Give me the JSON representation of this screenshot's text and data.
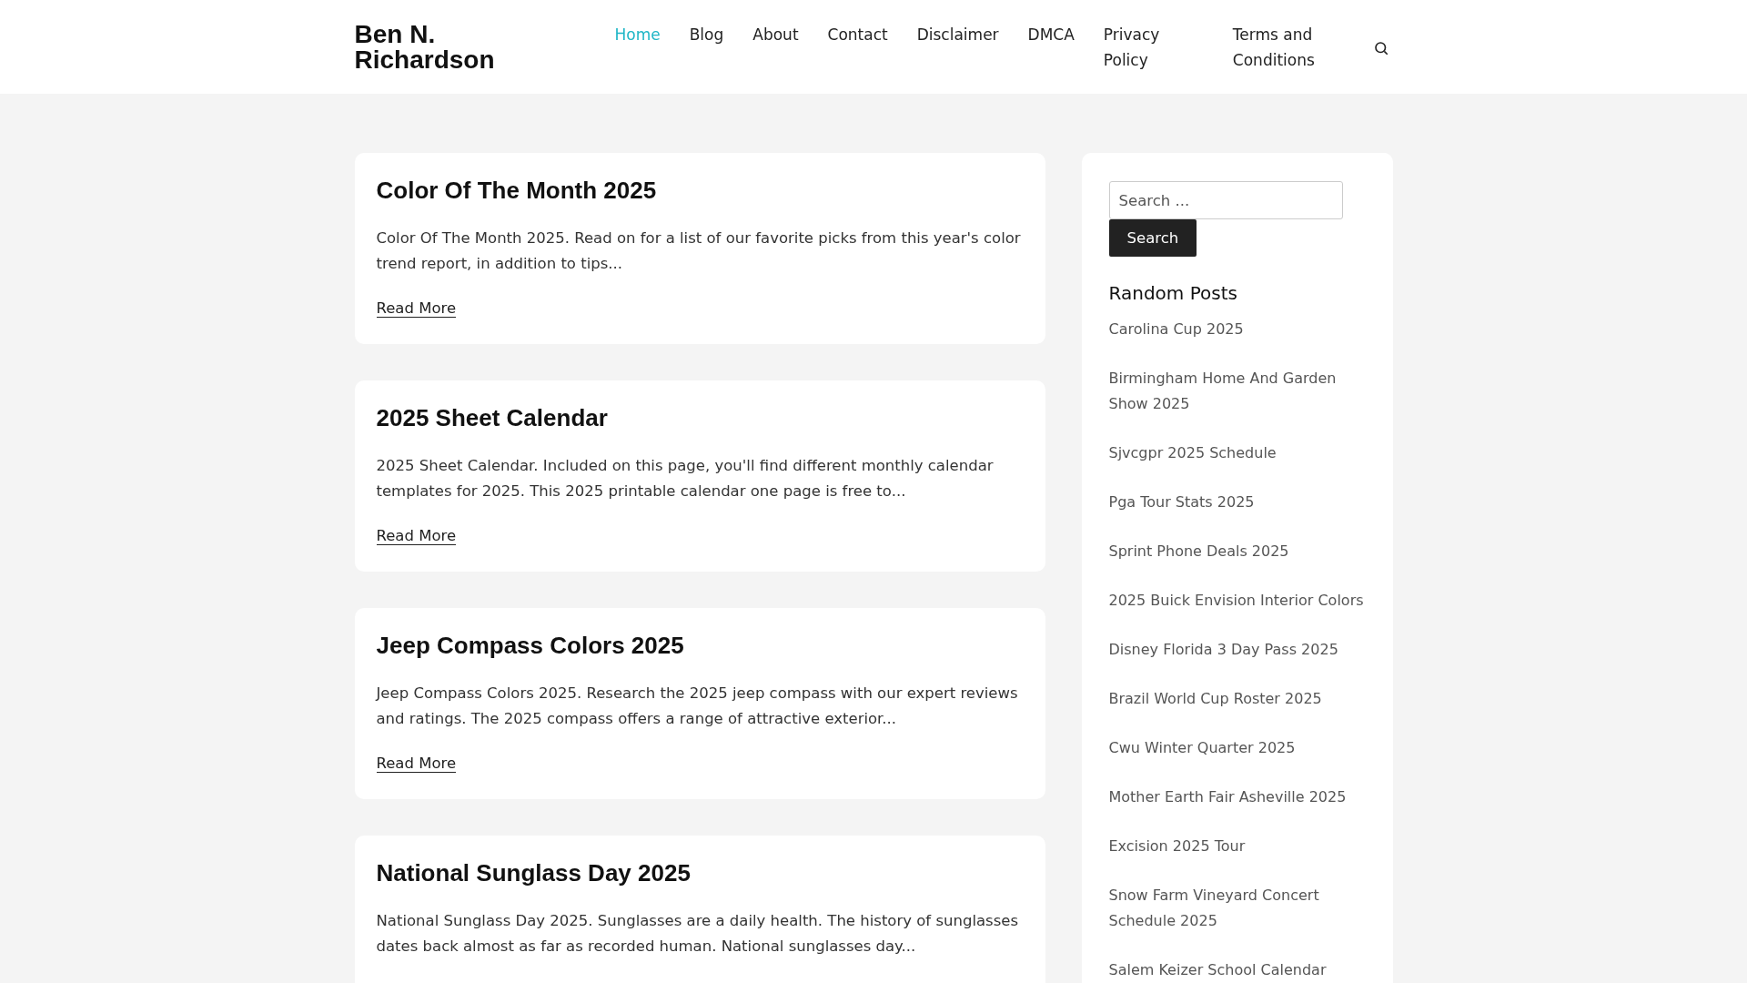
{
  "site_title": "Ben N. Richardson",
  "nav": [
    {
      "label": "Home",
      "selected": true
    },
    {
      "label": "Blog",
      "selected": false
    },
    {
      "label": "About",
      "selected": false
    },
    {
      "label": "Contact",
      "selected": false
    },
    {
      "label": "Disclaimer",
      "selected": false
    },
    {
      "label": "DMCA",
      "selected": false
    },
    {
      "label": "Privacy Policy",
      "selected": false
    },
    {
      "label": "Terms and Conditions",
      "selected": false
    }
  ],
  "posts": [
    {
      "title": "Color Of The Month 2025",
      "excerpt": "Color Of The Month 2025. Read on for a list of our favorite picks from this year's color trend report, in addition to tips...",
      "link": "Read More"
    },
    {
      "title": "2025 Sheet Calendar",
      "excerpt": "2025 Sheet Calendar. Included on this page, you'll find different monthly calendar templates for 2025. This 2025 printable calendar one page is free to...",
      "link": "Read More"
    },
    {
      "title": "Jeep Compass Colors 2025",
      "excerpt": "Jeep Compass Colors 2025. Research the 2025 jeep compass with our expert reviews and ratings. The 2025 compass offers a range of attractive exterior...",
      "link": "Read More"
    },
    {
      "title": "National Sunglass Day 2025",
      "excerpt": "National Sunglass Day 2025. Sunglasses are a daily health. The history of sunglasses dates back almost as far as recorded human. National sunglasses day..."
    }
  ],
  "sidebar": {
    "search": {
      "placeholder": "Search ...",
      "button": "Search"
    },
    "heading": "Random Posts",
    "items": [
      "Carolina Cup 2025",
      "Birmingham Home And Garden Show 2025",
      "Sjvcgpr 2025 Schedule",
      "Pga Tour Stats 2025",
      "Sprint Phone Deals 2025",
      "2025 Buick Envision Interior Colors",
      "Disney Florida 3 Day Pass 2025",
      "Brazil World Cup Roster 2025",
      "Cwu Winter Quarter 2025",
      "Mother Earth Fair Asheville 2025",
      "Excision 2025 Tour",
      "Snow Farm Vineyard Concert Schedule 2025",
      "Salem Keizer School Calendar"
    ]
  }
}
